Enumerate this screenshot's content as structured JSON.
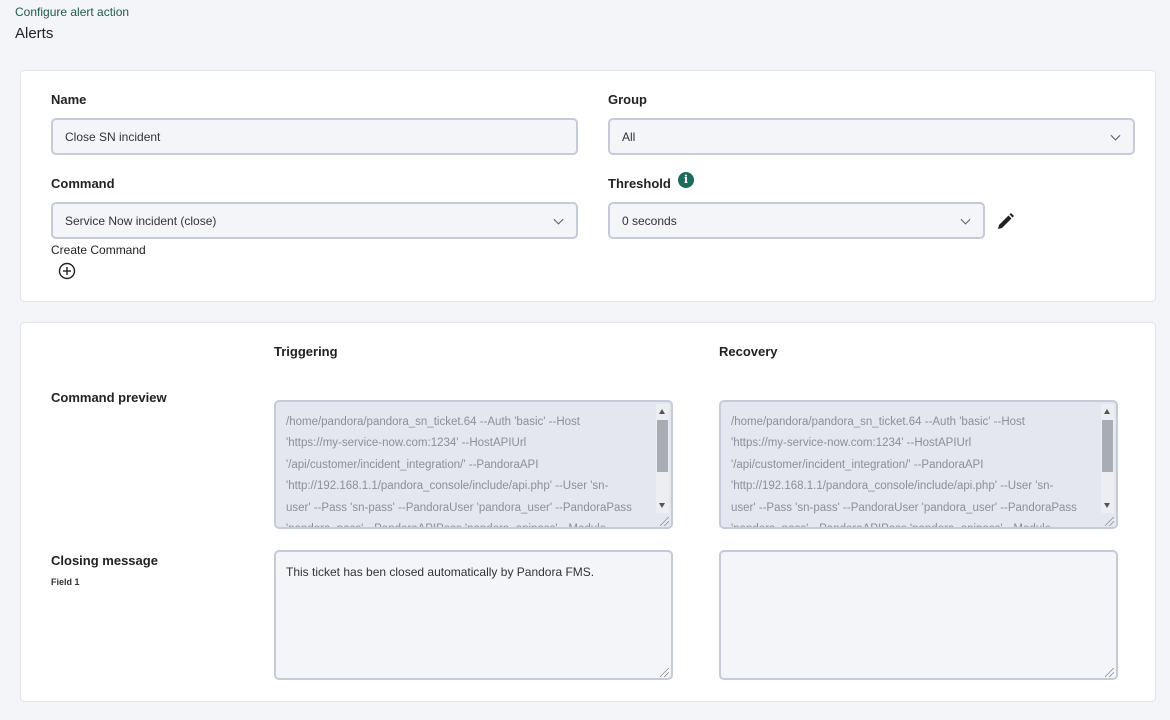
{
  "breadcrumb": "Configure alert action",
  "page_title": "Alerts",
  "form": {
    "name_label": "Name",
    "name_value": "Close SN incident",
    "group_label": "Group",
    "group_value": "All",
    "command_label": "Command",
    "command_value": "Service Now incident (close)",
    "create_command_label": "Create Command",
    "threshold_label": "Threshold",
    "threshold_value": "0 seconds"
  },
  "fields": {
    "triggering_header": "Triggering",
    "recovery_header": "Recovery",
    "command_preview_label": "Command preview",
    "closing_message_label": "Closing message",
    "closing_message_sublabel": "Field 1",
    "triggering_preview": "/home/pandora/pandora_sn_ticket.64 --Auth 'basic' --Host\n'https://my-service-now.com:1234' --HostAPIUrl\n'/api/customer/incident_integration/' --PandoraAPI\n'http://192.168.1.1/pandora_console/include/api.php' --User 'sn-\nuser' --Pass 'sn-pass' --PandoraUser 'pandora_user' --PandoraPass\n'pandora_pass' --PandoraAPIPass 'pandora_apipass' --Module",
    "recovery_preview": "/home/pandora/pandora_sn_ticket.64 --Auth 'basic' --Host\n'https://my-service-now.com:1234' --HostAPIUrl\n'/api/customer/incident_integration/' --PandoraAPI\n'http://192.168.1.1/pandora_console/include/api.php' --User 'sn-\nuser' --Pass 'sn-pass' --PandoraUser 'pandora_user' --PandoraPass\n'pandora_pass' --PandoraAPIPass 'pandora_apipass' --Module",
    "triggering_closing_message": "This ticket has ben closed automatically by Pandora FMS.",
    "recovery_closing_message": ""
  },
  "icons": {
    "info": "info-icon",
    "edit": "pencil-icon",
    "add": "plus-circle-icon"
  },
  "colors": {
    "accent": "#1d6b5b"
  }
}
